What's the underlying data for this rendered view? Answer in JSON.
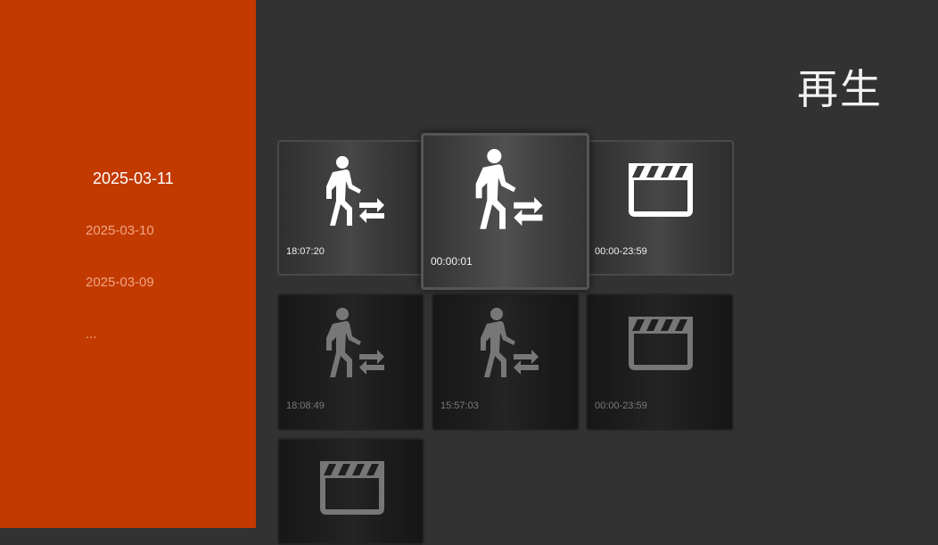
{
  "title": "再生",
  "dates": [
    "2025-03-11",
    "2025-03-10",
    "2025-03-09",
    "..."
  ],
  "cards": [
    {
      "icon": "motion-icon",
      "time": "18:07:20",
      "state": "bright"
    },
    {
      "icon": "motion-icon",
      "time": "00:00:01",
      "state": "focused"
    },
    {
      "icon": "clapperboard-icon",
      "time": "00:00-23:59",
      "state": "bright"
    },
    {
      "icon": "motion-icon",
      "time": "18:08:49",
      "state": "dim"
    },
    {
      "icon": "motion-icon",
      "time": "15:57:03",
      "state": "dim"
    },
    {
      "icon": "clapperboard-icon",
      "time": "00:00-23:59",
      "state": "dim"
    },
    {
      "icon": "clapperboard-icon",
      "time": "",
      "state": "dim"
    }
  ],
  "colors": {
    "sidebar": "#c23a00",
    "background": "#323232"
  }
}
